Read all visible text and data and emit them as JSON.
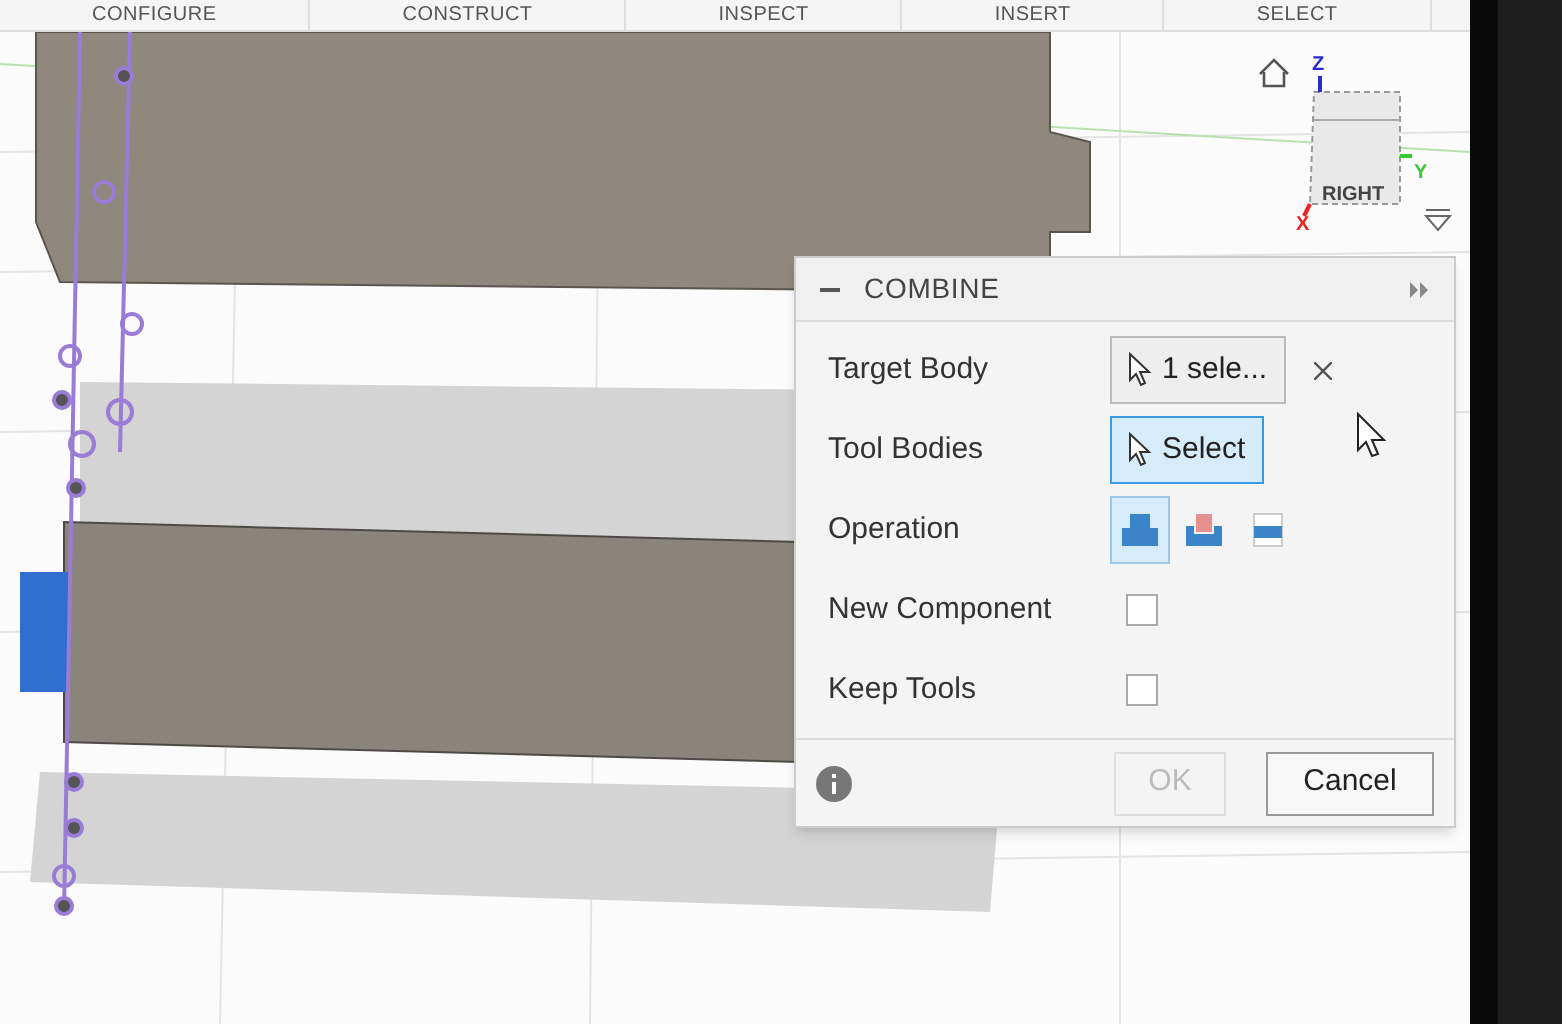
{
  "toolbar": {
    "tabs": [
      {
        "label": "CONFIGURE"
      },
      {
        "label": "CONSTRUCT"
      },
      {
        "label": "INSPECT"
      },
      {
        "label": "INSERT"
      },
      {
        "label": "SELECT"
      }
    ]
  },
  "view_cube": {
    "face": "RIGHT",
    "axes": [
      "Z",
      "Y",
      "X"
    ]
  },
  "dialog": {
    "title": "COMBINE",
    "rows": [
      {
        "kind": "selection",
        "label": "Target Body",
        "value": "1 sele...",
        "active": false,
        "clearable": true
      },
      {
        "kind": "selection",
        "label": "Tool Bodies",
        "value": "Select",
        "active": true,
        "clearable": false
      },
      {
        "kind": "operation",
        "label": "Operation",
        "options": [
          {
            "kind": "join",
            "selected": true
          },
          {
            "kind": "cut",
            "selected": false
          },
          {
            "kind": "intersect",
            "selected": false
          }
        ]
      },
      {
        "kind": "checkbox",
        "label": "New Component",
        "checked": false
      },
      {
        "kind": "checkbox",
        "label": "Keep Tools",
        "checked": false
      }
    ],
    "buttons": [
      {
        "label": "OK",
        "disabled": true
      },
      {
        "label": "Cancel",
        "disabled": false
      }
    ]
  }
}
